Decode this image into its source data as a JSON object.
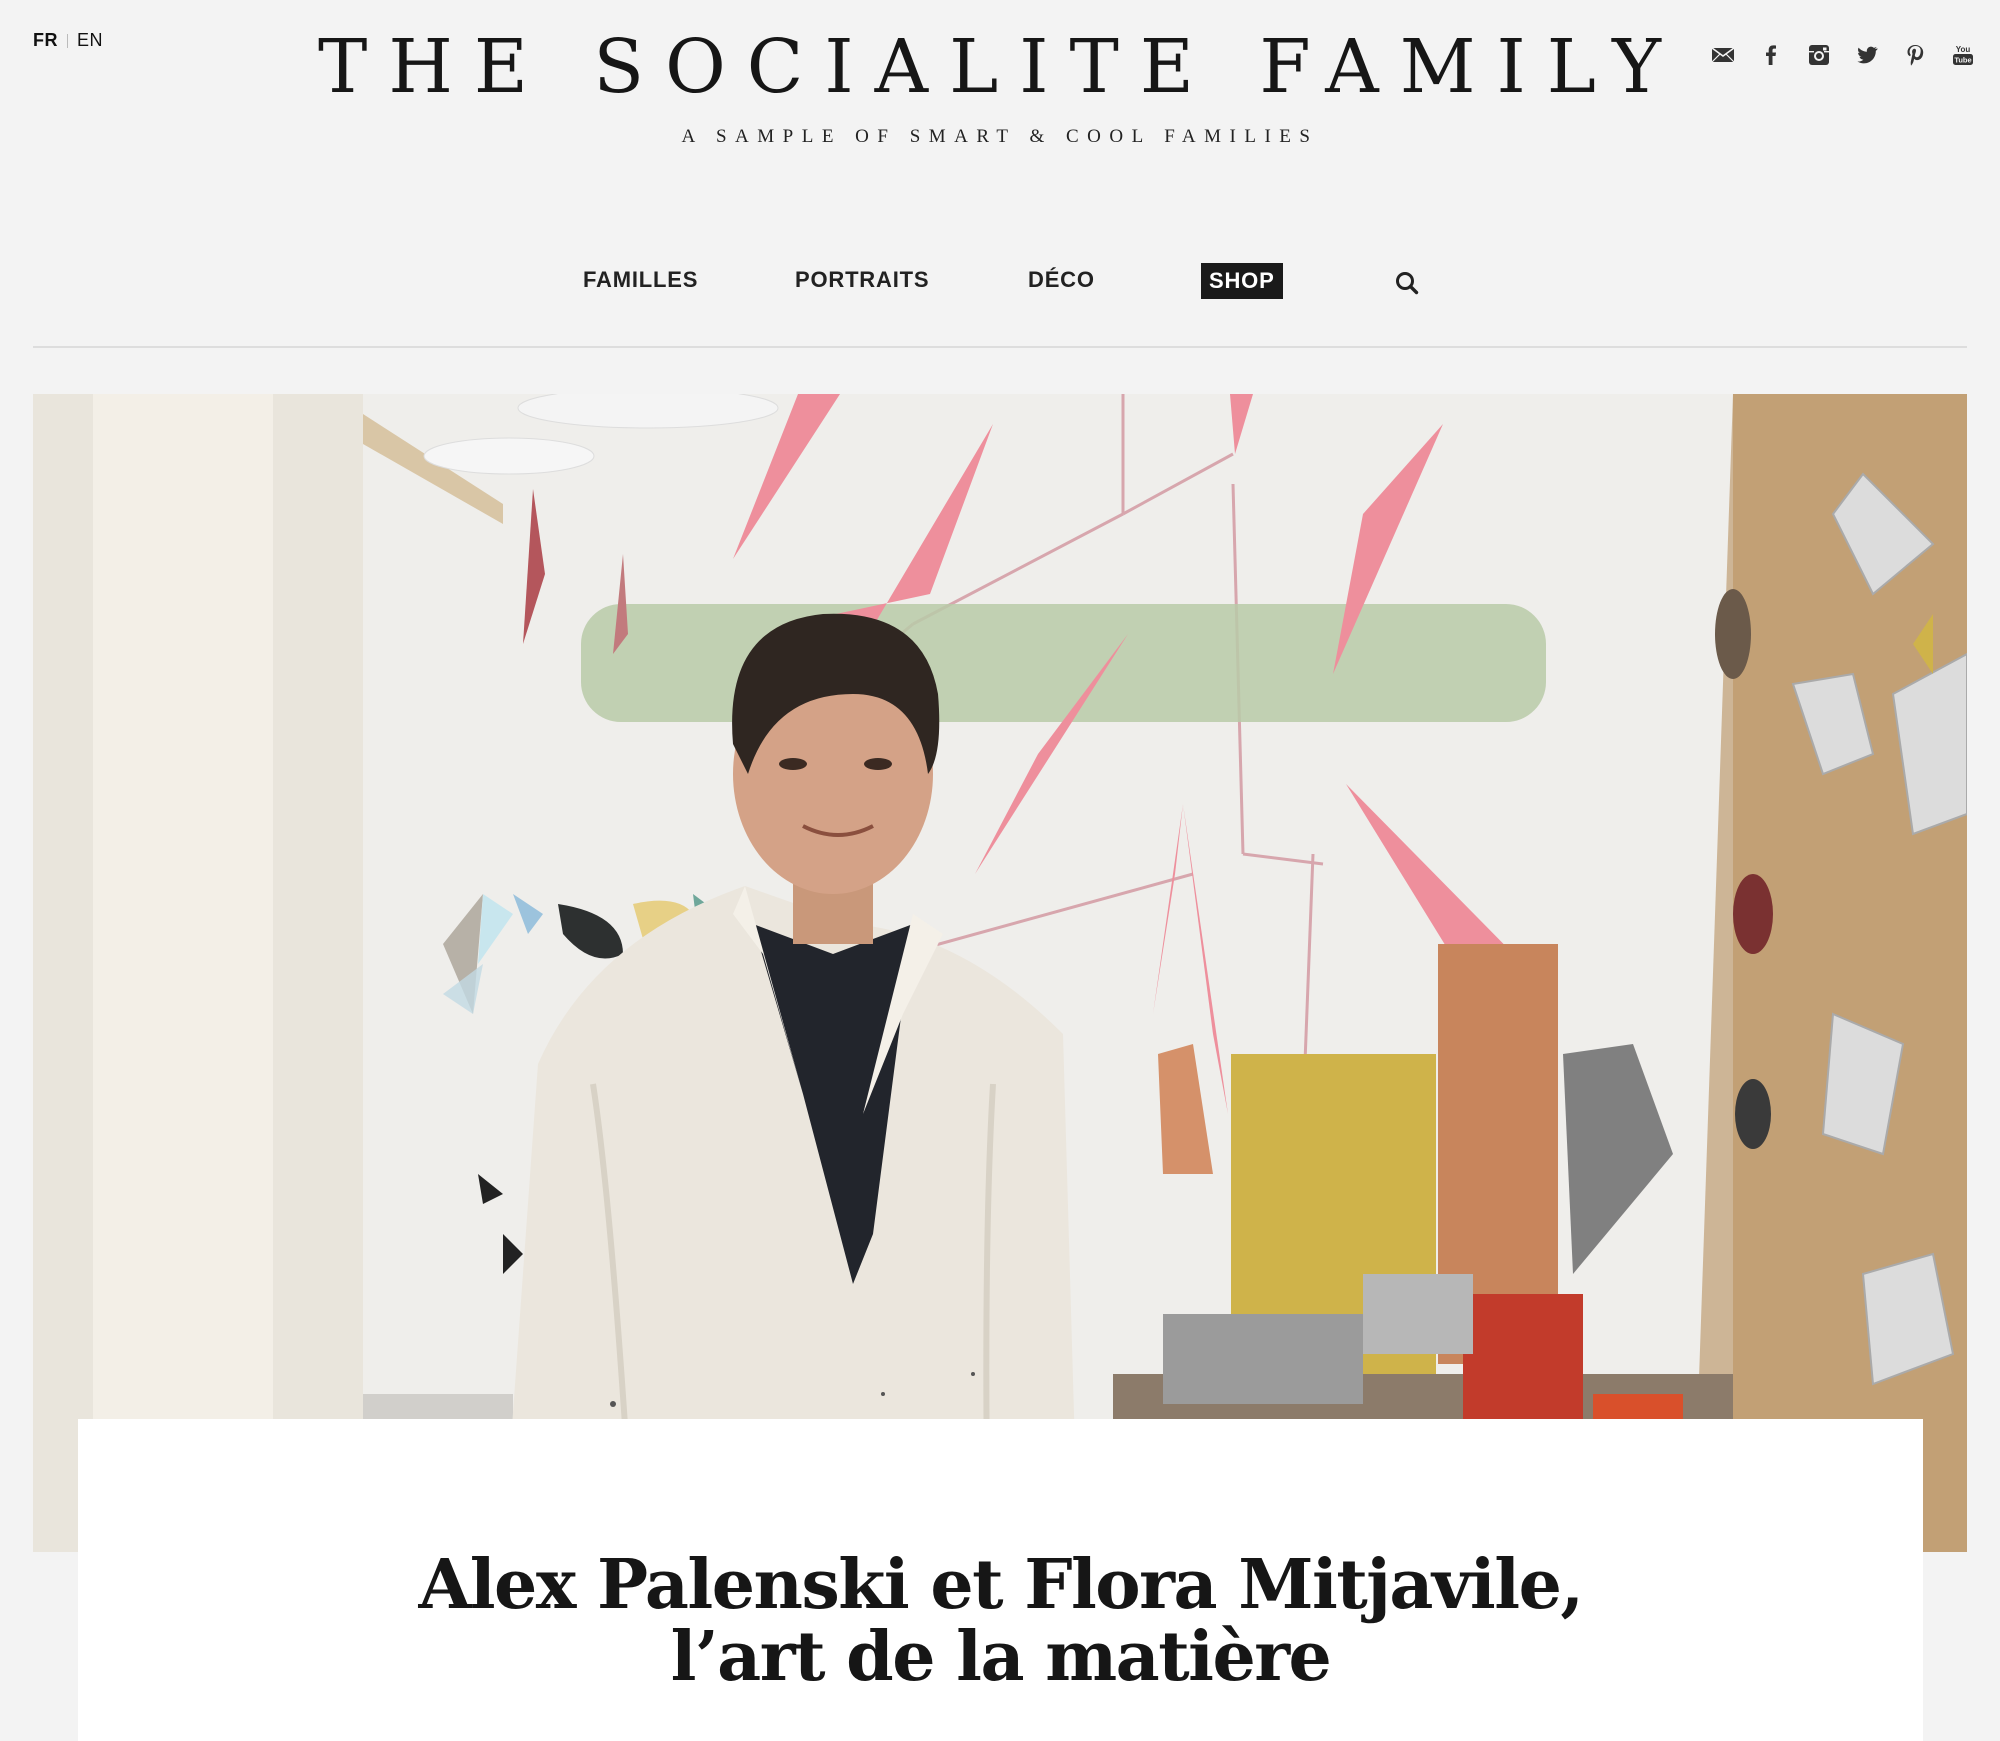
{
  "language": {
    "options": [
      "FR",
      "EN"
    ],
    "active": "FR"
  },
  "site": {
    "title": "THE SOCIALITE FAMILY",
    "tagline": "A SAMPLE OF SMART & COOL FAMILIES"
  },
  "social": {
    "icons": [
      "mail-icon",
      "facebook-icon",
      "instagram-icon",
      "twitter-icon",
      "pinterest-icon",
      "youtube-icon"
    ],
    "youtube_label": "You Tube"
  },
  "nav": {
    "items": [
      {
        "label": "FAMILLES"
      },
      {
        "label": "PORTRAITS"
      },
      {
        "label": "DÉCO"
      },
      {
        "label": "SHOP",
        "highlight": true
      }
    ],
    "search_icon": "search-icon"
  },
  "hero": {
    "image": "portrait-photo",
    "accent_colors": [
      "#ee8f9c",
      "#b4c8a8",
      "#c8855c",
      "#cfb34a"
    ]
  },
  "article": {
    "title_line1": "Alex Palenski et Flora Mitjavile,",
    "title_line2": "l’art de la matière"
  }
}
